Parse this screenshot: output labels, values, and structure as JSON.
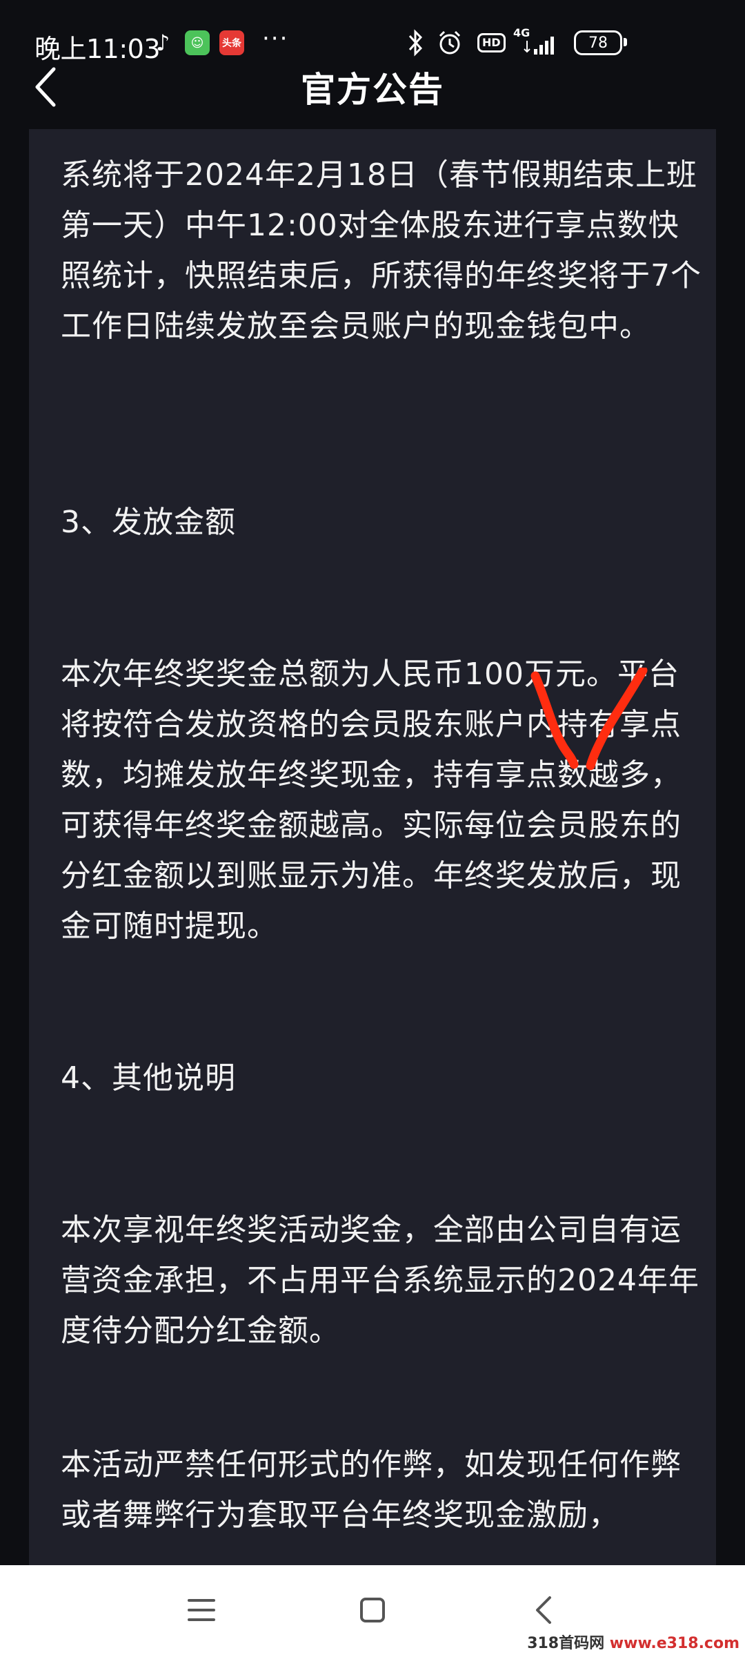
{
  "status_bar": {
    "time": "晚上11:03",
    "app_icons": [
      {
        "name": "tiktok-icon",
        "glyph": "♪"
      },
      {
        "name": "app-green-icon",
        "glyph": "☺"
      },
      {
        "name": "toutiao-icon",
        "glyph": "头条"
      }
    ],
    "more": "···",
    "hd": "HD",
    "network": "4G",
    "battery": "78"
  },
  "header": {
    "title": "官方公告"
  },
  "article": {
    "p1": "系统将于2024年2月18日（春节假期结束上班第一天）中午12:00对全体股东进行享点数快照统计，快照结束后，所获得的年终奖将于7个工作日陆续发放至会员账户的现金钱包中。",
    "h3": "3、发放金额",
    "p3": "本次年终奖奖金总额为人民币100万元。平台将按符合发放资格的会员股东账户内持有享点数，均摊发放年终奖现金，持有享点数越多，可获得年终奖金额越高。实际每位会员股东的分红金额以到账显示为准。年终奖发放后，现金可随时提现。",
    "h4": "4、其他说明",
    "p4": "本次享视年终奖活动奖金，全部由公司自有运营资金承担，不占用平台系统显示的2024年年度待分配分红金额。",
    "p5": "本活动严禁任何形式的作弊，如发现任何作弊或者舞弊行为套取平台年终奖现金激励，"
  },
  "watermark": {
    "site": "318首码网",
    "url": "www.e318.com"
  },
  "colors": {
    "background": "#0d0e12",
    "card": "#1f202a",
    "text": "#f2f2f2",
    "annotation": "#ff2d10"
  }
}
